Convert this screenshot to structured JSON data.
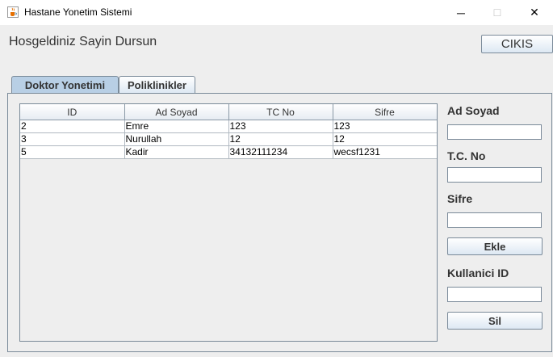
{
  "window": {
    "title": "Hastane Yonetim Sistemi",
    "minimize": "─",
    "maximize": "☐",
    "close": "✕",
    "icon": "java-cup-icon"
  },
  "header": {
    "welcome": "Hosgeldiniz Sayin Dursun",
    "exit_label": "CIKIS"
  },
  "tabs": [
    {
      "label": "Doktor Yonetimi",
      "active": true
    },
    {
      "label": "Poliklinikler",
      "active": false
    }
  ],
  "table": {
    "columns": [
      "ID",
      "Ad Soyad",
      "TC No",
      "Sifre"
    ],
    "rows": [
      [
        "2",
        "Emre",
        "123",
        "123"
      ],
      [
        "3",
        "Nurullah",
        "12",
        "12"
      ],
      [
        "5",
        "Kadir",
        "34132111234",
        "wecsf1231"
      ]
    ]
  },
  "form": {
    "name_label": "Ad Soyad",
    "name_value": "",
    "tc_label": "T.C. No",
    "tc_value": "",
    "password_label": "Sifre",
    "password_value": "",
    "add_label": "Ekle",
    "user_id_label": "Kullanici ID",
    "user_id_value": "",
    "delete_label": "Sil"
  }
}
